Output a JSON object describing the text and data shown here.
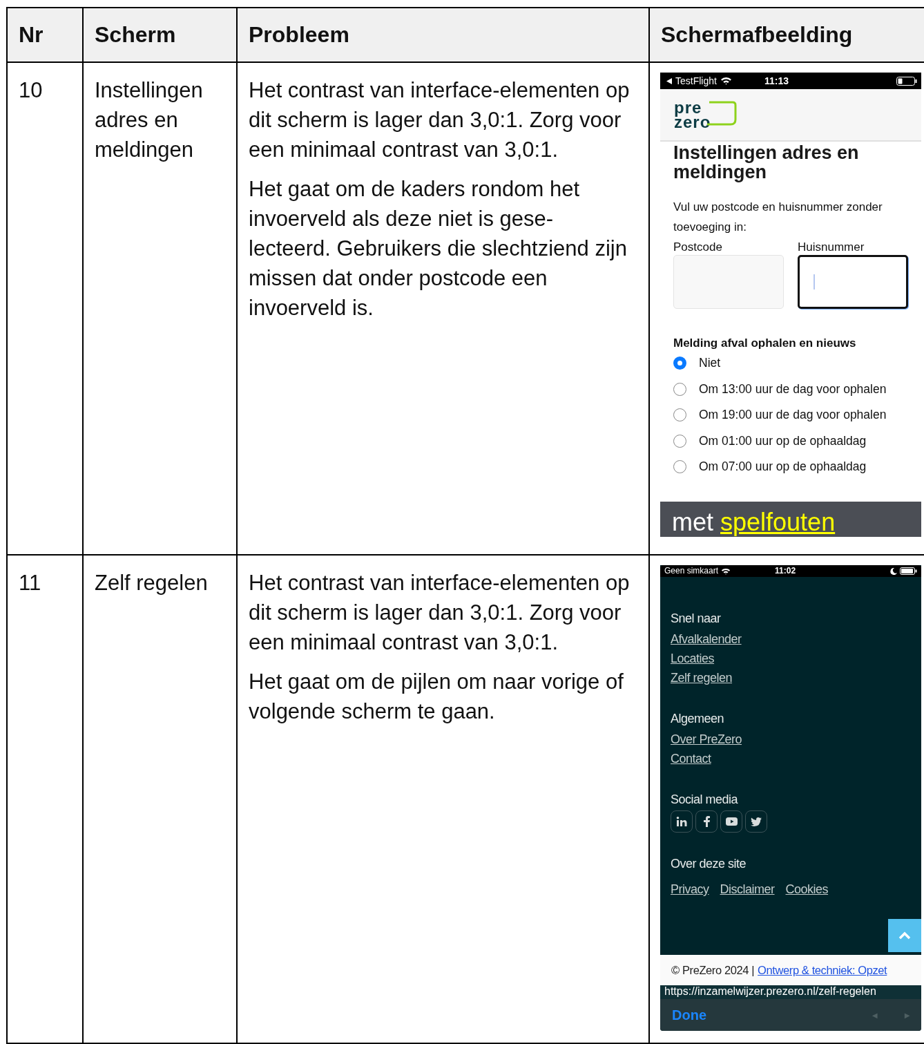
{
  "table": {
    "columns": [
      "Nr",
      "Scherm",
      "Probleem",
      "Schermafbeelding"
    ],
    "rows": [
      {
        "nr": "10",
        "screen": "Instellingen adres en meldingen",
        "problem": [
          "Het contrast van interface-elementen op dit scherm is lager dan 3,0:1. Zorg voor een minimaal contrast van 3,0:1.",
          "Het gaat om de kaders rondom het invoerveld als deze niet is gese-lecteerd. Gebruikers die slechtziend zijn missen dat onder postcode een invoerveld is."
        ],
        "screenshot": {
          "kind": "settings",
          "status": {
            "carrier": "TestFlight",
            "time": "11:13"
          },
          "logo": [
            "pre",
            "zero"
          ],
          "title": "Instellingen adres en meldingen",
          "intro": "Vul uw postcode en huisnummer zonder toevoeging in:",
          "fields": [
            {
              "label": "Postcode",
              "focused": false
            },
            {
              "label": "Huisnummer",
              "focused": true
            }
          ],
          "radio_title": "Melding afval ophalen en nieuws",
          "options": [
            {
              "label": "Niet",
              "selected": true
            },
            {
              "label": "Om 13:00 uur de dag voor ophalen",
              "selected": false
            },
            {
              "label": "Om 19:00 uur de dag voor ophalen",
              "selected": false
            },
            {
              "label": "Om 01:00 uur op de ophaaldag",
              "selected": false
            },
            {
              "label": "Om 07:00 uur op de ophaaldag",
              "selected": false
            }
          ],
          "caption": {
            "text": "met",
            "highlight": "spelfouten"
          }
        }
      },
      {
        "nr": "11",
        "screen": "Zelf regelen",
        "problem": [
          "Het contrast van interface-elementen op dit scherm is lager dan 3,0:1. Zorg voor een minimaal contrast van 3,0:1.",
          "Het gaat om de pijlen om naar vorige of volgende scherm te gaan."
        ],
        "screenshot": {
          "kind": "footer",
          "status": {
            "carrier": "Geen simkaart",
            "time": "11:02"
          },
          "sections": [
            {
              "kind": "list",
              "heading": "Snel naar",
              "links": [
                "Afvalkalender",
                "Locaties",
                "Zelf regelen"
              ]
            },
            {
              "kind": "list",
              "heading": "Algemeen",
              "links": [
                "Over PreZero",
                "Contact"
              ]
            },
            {
              "kind": "social",
              "heading": "Social media"
            },
            {
              "kind": "inline",
              "heading": "Over deze site",
              "links": [
                "Privacy",
                "Disclaimer",
                "Cookies"
              ]
            }
          ],
          "copyright": "© PreZero 2024 |",
          "credit": "Ontwerp & techniek: Opzet",
          "url": "https://inzamelwijzer.prezero.nl/zelf-regelen",
          "done": "Done",
          "nav": [
            {
              "label": "◄",
              "disabled": true
            },
            {
              "label": "►",
              "disabled": true
            }
          ]
        }
      }
    ]
  }
}
